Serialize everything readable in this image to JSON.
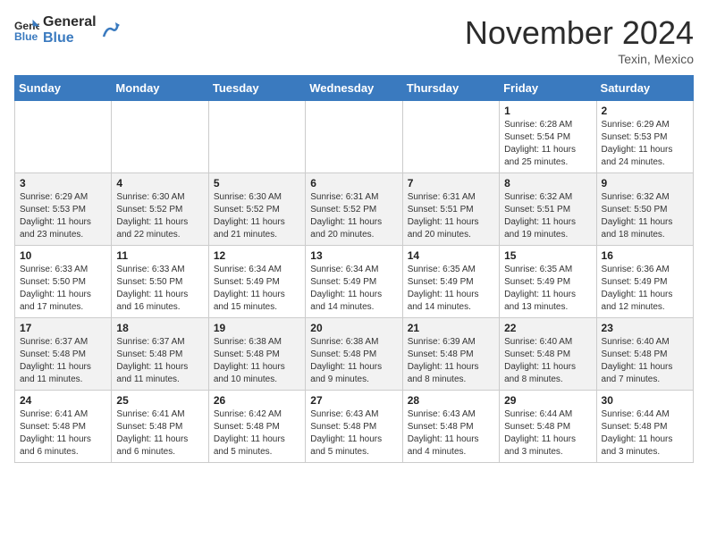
{
  "header": {
    "logo_line1": "General",
    "logo_line2": "Blue",
    "month": "November 2024",
    "location": "Texin, Mexico"
  },
  "weekdays": [
    "Sunday",
    "Monday",
    "Tuesday",
    "Wednesday",
    "Thursday",
    "Friday",
    "Saturday"
  ],
  "weeks": [
    [
      {
        "day": "",
        "info": ""
      },
      {
        "day": "",
        "info": ""
      },
      {
        "day": "",
        "info": ""
      },
      {
        "day": "",
        "info": ""
      },
      {
        "day": "",
        "info": ""
      },
      {
        "day": "1",
        "info": "Sunrise: 6:28 AM\nSunset: 5:54 PM\nDaylight: 11 hours and 25 minutes."
      },
      {
        "day": "2",
        "info": "Sunrise: 6:29 AM\nSunset: 5:53 PM\nDaylight: 11 hours and 24 minutes."
      }
    ],
    [
      {
        "day": "3",
        "info": "Sunrise: 6:29 AM\nSunset: 5:53 PM\nDaylight: 11 hours and 23 minutes."
      },
      {
        "day": "4",
        "info": "Sunrise: 6:30 AM\nSunset: 5:52 PM\nDaylight: 11 hours and 22 minutes."
      },
      {
        "day": "5",
        "info": "Sunrise: 6:30 AM\nSunset: 5:52 PM\nDaylight: 11 hours and 21 minutes."
      },
      {
        "day": "6",
        "info": "Sunrise: 6:31 AM\nSunset: 5:52 PM\nDaylight: 11 hours and 20 minutes."
      },
      {
        "day": "7",
        "info": "Sunrise: 6:31 AM\nSunset: 5:51 PM\nDaylight: 11 hours and 20 minutes."
      },
      {
        "day": "8",
        "info": "Sunrise: 6:32 AM\nSunset: 5:51 PM\nDaylight: 11 hours and 19 minutes."
      },
      {
        "day": "9",
        "info": "Sunrise: 6:32 AM\nSunset: 5:50 PM\nDaylight: 11 hours and 18 minutes."
      }
    ],
    [
      {
        "day": "10",
        "info": "Sunrise: 6:33 AM\nSunset: 5:50 PM\nDaylight: 11 hours and 17 minutes."
      },
      {
        "day": "11",
        "info": "Sunrise: 6:33 AM\nSunset: 5:50 PM\nDaylight: 11 hours and 16 minutes."
      },
      {
        "day": "12",
        "info": "Sunrise: 6:34 AM\nSunset: 5:49 PM\nDaylight: 11 hours and 15 minutes."
      },
      {
        "day": "13",
        "info": "Sunrise: 6:34 AM\nSunset: 5:49 PM\nDaylight: 11 hours and 14 minutes."
      },
      {
        "day": "14",
        "info": "Sunrise: 6:35 AM\nSunset: 5:49 PM\nDaylight: 11 hours and 14 minutes."
      },
      {
        "day": "15",
        "info": "Sunrise: 6:35 AM\nSunset: 5:49 PM\nDaylight: 11 hours and 13 minutes."
      },
      {
        "day": "16",
        "info": "Sunrise: 6:36 AM\nSunset: 5:49 PM\nDaylight: 11 hours and 12 minutes."
      }
    ],
    [
      {
        "day": "17",
        "info": "Sunrise: 6:37 AM\nSunset: 5:48 PM\nDaylight: 11 hours and 11 minutes."
      },
      {
        "day": "18",
        "info": "Sunrise: 6:37 AM\nSunset: 5:48 PM\nDaylight: 11 hours and 11 minutes."
      },
      {
        "day": "19",
        "info": "Sunrise: 6:38 AM\nSunset: 5:48 PM\nDaylight: 11 hours and 10 minutes."
      },
      {
        "day": "20",
        "info": "Sunrise: 6:38 AM\nSunset: 5:48 PM\nDaylight: 11 hours and 9 minutes."
      },
      {
        "day": "21",
        "info": "Sunrise: 6:39 AM\nSunset: 5:48 PM\nDaylight: 11 hours and 8 minutes."
      },
      {
        "day": "22",
        "info": "Sunrise: 6:40 AM\nSunset: 5:48 PM\nDaylight: 11 hours and 8 minutes."
      },
      {
        "day": "23",
        "info": "Sunrise: 6:40 AM\nSunset: 5:48 PM\nDaylight: 11 hours and 7 minutes."
      }
    ],
    [
      {
        "day": "24",
        "info": "Sunrise: 6:41 AM\nSunset: 5:48 PM\nDaylight: 11 hours and 6 minutes."
      },
      {
        "day": "25",
        "info": "Sunrise: 6:41 AM\nSunset: 5:48 PM\nDaylight: 11 hours and 6 minutes."
      },
      {
        "day": "26",
        "info": "Sunrise: 6:42 AM\nSunset: 5:48 PM\nDaylight: 11 hours and 5 minutes."
      },
      {
        "day": "27",
        "info": "Sunrise: 6:43 AM\nSunset: 5:48 PM\nDaylight: 11 hours and 5 minutes."
      },
      {
        "day": "28",
        "info": "Sunrise: 6:43 AM\nSunset: 5:48 PM\nDaylight: 11 hours and 4 minutes."
      },
      {
        "day": "29",
        "info": "Sunrise: 6:44 AM\nSunset: 5:48 PM\nDaylight: 11 hours and 3 minutes."
      },
      {
        "day": "30",
        "info": "Sunrise: 6:44 AM\nSunset: 5:48 PM\nDaylight: 11 hours and 3 minutes."
      }
    ]
  ]
}
